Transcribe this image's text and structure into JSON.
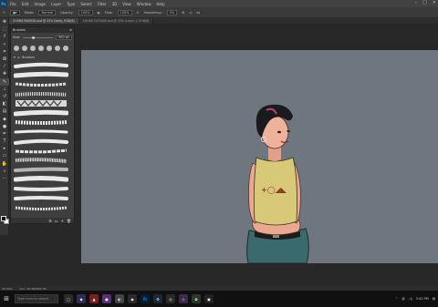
{
  "app": {
    "logo": "Ps"
  },
  "menubar": [
    "File",
    "Edit",
    "Image",
    "Layer",
    "Type",
    "Select",
    "Filter",
    "3D",
    "View",
    "Window",
    "Help"
  ],
  "options": {
    "mode_label": "Mode:",
    "mode_value": "Normal",
    "opacity_label": "Opacity:",
    "opacity_value": "100%",
    "flow_label": "Flow:",
    "flow_value": "100%",
    "smoothing_label": "Smoothing:",
    "smoothing_value": "0%"
  },
  "tabs": [
    {
      "label": "CHUNS MAKING.psd @ 33% (body, RGB/8)",
      "active": true
    },
    {
      "label": "CHUNS OUTLINE.psd @ 33% (Layer 1, RGB/8)",
      "active": false
    }
  ],
  "brushes_panel": {
    "title": "Brushes",
    "size_label": "Size:",
    "size_value": "300 px",
    "group_label": "Brushes"
  },
  "status": {
    "zoom": "33.33%",
    "doc": "Doc: 34.3M/282.7M"
  },
  "taskbar": {
    "search_placeholder": "Type here to search",
    "time": "3:42 PM",
    "date": "5/12/2021"
  },
  "colors": {
    "canvas_bg": "#6e767f",
    "panel_bg": "#3e3e3e",
    "accent": "#31a8ff"
  }
}
